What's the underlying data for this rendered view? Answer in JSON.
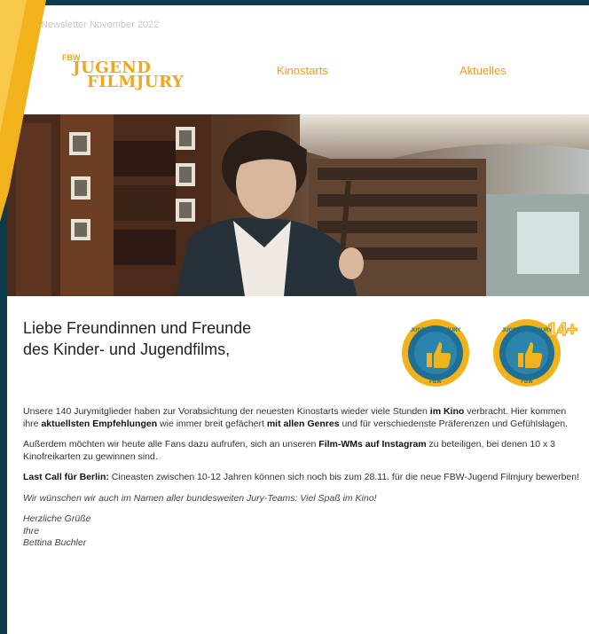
{
  "preheader": "Newsletter November 2022",
  "logo": {
    "top": "FBW",
    "line1": "JUGEND",
    "line2": "FILMJURY"
  },
  "nav": [
    {
      "label": "Kinostarts"
    },
    {
      "label": "Aktuelles"
    }
  ],
  "greeting": {
    "line1": "Liebe Freundinnen und Freunde",
    "line2": "des Kinder- und Jugendfilms,"
  },
  "badges": [
    {
      "ring_text": "JUGEND FILMJURY",
      "bottom": "FBW",
      "age": ""
    },
    {
      "ring_text": "JUGEND FILMJURY",
      "bottom": "FBW",
      "age": "14+"
    }
  ],
  "p1": {
    "t1": "Unsere 140 Jurymitglieder haben zur Vorabsichtung der neuesten Kinostarts wieder viele Stunden ",
    "b1": "im Kino",
    "t2": " verbracht. Hier kommen ihre ",
    "b2": "aktuellsten Empfehlungen",
    "t3": " wie immer breit gefächert ",
    "b3": "mit allen Genres",
    "t4": " und für verschiedenste Präferenzen und Gefühlslagen."
  },
  "p2": {
    "t1": "Außerdem möchten wir heute alle Fans dazu aufrufen, sich an unseren ",
    "b1": "Film-WMs auf Instagram",
    "t2": " zu beteiligen, bei denen 10 x 3 Kinofreikarten zu gewinnen sind."
  },
  "p3": {
    "b1": "Last Call für Berlin:",
    "t1": " Cineasten zwischen 10-12 Jahren können sich noch bis zum 28.11. für die neue FBW-Jugend Filmjury bewerben!"
  },
  "p4": "Wir wünschen wir auch im Namen aller bundesweiten Jury-Teams: Viel Spaß im Kino!",
  "signoff": {
    "l1": "Herzliche Grüße",
    "l2": "Ihre",
    "l3": "Bettina Buchler"
  },
  "colors": {
    "accent": "#f29a1b",
    "frame": "#0e3a4d",
    "badge_blue": "#1f6f95",
    "badge_gold": "#f2b21b"
  }
}
